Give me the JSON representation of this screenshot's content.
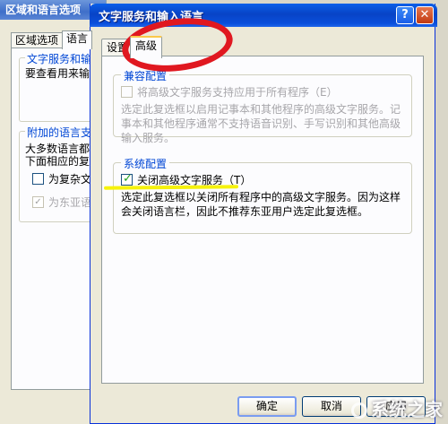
{
  "background_dialog": {
    "title": "区域和语言选项",
    "tabs": [
      "区域选项",
      "语言"
    ],
    "group1": {
      "title": "文字服务和输",
      "text": "要查看用来输"
    },
    "group2": {
      "title": "附加的语言支",
      "lines": [
        "大多数语言都",
        "下面相应的复"
      ],
      "checkbox1_label": "为复杂文",
      "checkbox2_label": "为东亚语"
    }
  },
  "dialog": {
    "title": "文字服务和输入语言",
    "help_glyph": "?",
    "close_glyph": "✕",
    "tabs": [
      "设置",
      "高级"
    ],
    "active_tab": "高级",
    "compat_group": {
      "title": "兼容配置",
      "checkbox_label": "将高级文字服务支持应用于所有程序（E）",
      "checked": false,
      "enabled": false,
      "description": "选定此复选框以启用记事本和其他程序的高级文字服务。记事本和其他程序通常不支持语音识别、手写识别和其他高级输入服务。"
    },
    "system_group": {
      "title": "系统配置",
      "checkbox_label": "关闭高级文字服务（T）",
      "checked": true,
      "enabled": true,
      "description": "选定此复选框以关闭所有程序中的高级文字服务。因为这样会关闭语言栏，因此不推荐东亚用户选定此复选框。"
    },
    "buttons": {
      "ok": "确定",
      "cancel": "取消",
      "apply": "应用"
    }
  },
  "watermark": "系统之家",
  "colors": {
    "accent_annotation_ring": "#e01820",
    "annotation_underline": "#f6f20c",
    "group_title": "#0046d5"
  }
}
